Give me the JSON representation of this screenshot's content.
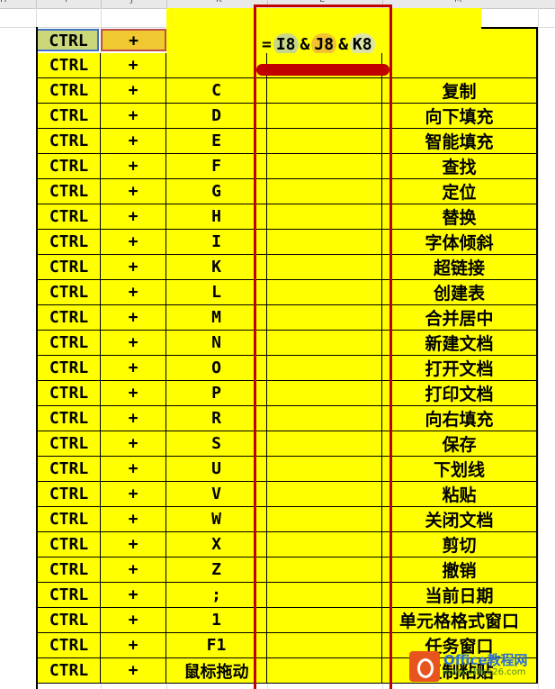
{
  "column_headers": [
    "H",
    "I",
    "J",
    "K",
    "L",
    "M"
  ],
  "formula_cell": {
    "prefix": "=",
    "ref1": "I8",
    "amp1": "&",
    "ref2": "J8",
    "amp2": "&",
    "ref3": "K8"
  },
  "header_row": {
    "ctrl": "CTRL",
    "plus": "+"
  },
  "rows": [
    {
      "ctrl": "CTRL",
      "plus": "+",
      "key": "",
      "result": "",
      "desc": ""
    },
    {
      "ctrl": "CTRL",
      "plus": "+",
      "key": "C",
      "result": "",
      "desc": "复制"
    },
    {
      "ctrl": "CTRL",
      "plus": "+",
      "key": "D",
      "result": "",
      "desc": "向下填充"
    },
    {
      "ctrl": "CTRL",
      "plus": "+",
      "key": "E",
      "result": "",
      "desc": "智能填充"
    },
    {
      "ctrl": "CTRL",
      "plus": "+",
      "key": "F",
      "result": "",
      "desc": "查找"
    },
    {
      "ctrl": "CTRL",
      "plus": "+",
      "key": "G",
      "result": "",
      "desc": "定位"
    },
    {
      "ctrl": "CTRL",
      "plus": "+",
      "key": "H",
      "result": "",
      "desc": "替换"
    },
    {
      "ctrl": "CTRL",
      "plus": "+",
      "key": "I",
      "result": "",
      "desc": "字体倾斜"
    },
    {
      "ctrl": "CTRL",
      "plus": "+",
      "key": "K",
      "result": "",
      "desc": "超链接"
    },
    {
      "ctrl": "CTRL",
      "plus": "+",
      "key": "L",
      "result": "",
      "desc": "创建表"
    },
    {
      "ctrl": "CTRL",
      "plus": "+",
      "key": "M",
      "result": "",
      "desc": "合并居中"
    },
    {
      "ctrl": "CTRL",
      "plus": "+",
      "key": "N",
      "result": "",
      "desc": "新建文档"
    },
    {
      "ctrl": "CTRL",
      "plus": "+",
      "key": "O",
      "result": "",
      "desc": "打开文档"
    },
    {
      "ctrl": "CTRL",
      "plus": "+",
      "key": "P",
      "result": "",
      "desc": "打印文档"
    },
    {
      "ctrl": "CTRL",
      "plus": "+",
      "key": "R",
      "result": "",
      "desc": "向右填充"
    },
    {
      "ctrl": "CTRL",
      "plus": "+",
      "key": "S",
      "result": "",
      "desc": "保存"
    },
    {
      "ctrl": "CTRL",
      "plus": "+",
      "key": "U",
      "result": "",
      "desc": "下划线"
    },
    {
      "ctrl": "CTRL",
      "plus": "+",
      "key": "V",
      "result": "",
      "desc": "粘贴"
    },
    {
      "ctrl": "CTRL",
      "plus": "+",
      "key": "W",
      "result": "",
      "desc": "关闭文档"
    },
    {
      "ctrl": "CTRL",
      "plus": "+",
      "key": "X",
      "result": "",
      "desc": "剪切"
    },
    {
      "ctrl": "CTRL",
      "plus": "+",
      "key": "Z",
      "result": "",
      "desc": "撤销"
    },
    {
      "ctrl": "CTRL",
      "plus": "+",
      "key": ";",
      "result": "",
      "desc": "当前日期"
    },
    {
      "ctrl": "CTRL",
      "plus": "+",
      "key": "1",
      "result": "",
      "desc": "单元格格式窗口"
    },
    {
      "ctrl": "CTRL",
      "plus": "+",
      "key": "F1",
      "result": "",
      "desc": "任务窗口"
    },
    {
      "ctrl": "CTRL",
      "plus": "+",
      "key": "鼠标拖动",
      "result": "",
      "desc": "复制粘贴"
    }
  ],
  "watermark": {
    "title": "Office教程网",
    "url": "www.office26.com"
  },
  "colors": {
    "cell_fill": "#ffff00",
    "highlight_red": "#c00000",
    "ref_i": "#c7d78a",
    "ref_j": "#f1c232",
    "sel_i_border": "#4472c4",
    "sel_j_border": "#c0504d"
  }
}
